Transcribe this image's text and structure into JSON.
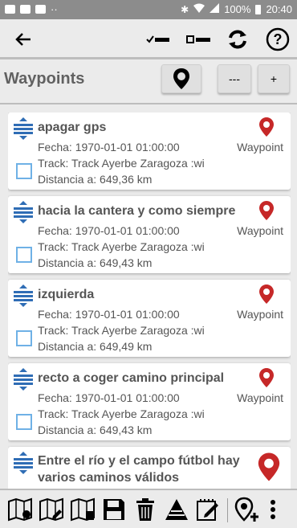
{
  "status_bar": {
    "battery": "100%",
    "time": "20:40",
    "dots": "··"
  },
  "header": {
    "icons": [
      "back-arrow-icon",
      "select-all-icon",
      "deselect-all-icon",
      "sync-icon",
      "help-icon"
    ]
  },
  "page": {
    "title": "Waypoints",
    "minus_label": "---",
    "plus_label": "+"
  },
  "waypoints": [
    {
      "name": "apagar gps",
      "fecha": "Fecha: 1970-01-01 01:00:00",
      "track": "Track: Track Ayerbe Zaragoza :wi",
      "distancia": "Distancia a: 649,36 km",
      "type": "Waypoint"
    },
    {
      "name": "hacia la cantera y como siempre",
      "fecha": "Fecha: 1970-01-01 01:00:00",
      "track": "Track: Track Ayerbe Zaragoza :wi",
      "distancia": "Distancia a: 649,43 km",
      "type": "Waypoint"
    },
    {
      "name": "izquierda",
      "fecha": "Fecha: 1970-01-01 01:00:00",
      "track": "Track: Track Ayerbe Zaragoza :wi",
      "distancia": "Distancia a: 649,49 km",
      "type": "Waypoint"
    },
    {
      "name": "recto a coger camino principal",
      "fecha": "Fecha: 1970-01-01 01:00:00",
      "track": "Track: Track Ayerbe Zaragoza :wi",
      "distancia": "Distancia a: 649,43 km",
      "type": "Waypoint"
    },
    {
      "name": "Entre el río y el campo fútbol hay varios caminos válidos"
    }
  ],
  "bottom_bar": {
    "icons": [
      "map-route-icon",
      "map-edit-icon",
      "map-export-icon",
      "save-icon",
      "trash-icon",
      "elevation-icon",
      "edit-note-icon",
      "add-waypoint-icon",
      "overflow-menu-icon"
    ]
  },
  "colors": {
    "accent_red": "#c62828",
    "checkbox_blue": "#6fb1e6",
    "drag_blue": "#2f6db5",
    "text": "#555555"
  }
}
